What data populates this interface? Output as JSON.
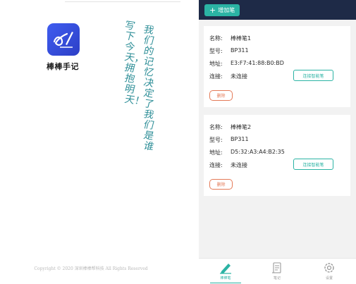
{
  "splash": {
    "app_name": "棒棒手记",
    "poem_col1": "我们的记忆决定了我们是谁",
    "poem_col2": "写下今天，拥抱明天！",
    "copyright": "Copyright © 2020 深圳棒棒帮科技 All Rights Reserved",
    "icon": "pen-alpha-icon"
  },
  "pen_list": {
    "add_button": "增加笔",
    "labels": {
      "name": "名称:",
      "model": "型号:",
      "address": "地址:",
      "connection": "连接:"
    },
    "pens": [
      {
        "name": "棒棒笔1",
        "model": "BP311",
        "address": "E3:F7:41:88:B0:BD",
        "status": "未连接",
        "connect": "连接智能笔",
        "delete": "删除"
      },
      {
        "name": "棒棒笔2",
        "model": "BP311",
        "address": "D5:32:A3:A4:B2:35",
        "status": "未连接",
        "connect": "连接智能笔",
        "delete": "删除"
      }
    ]
  },
  "tabs": [
    {
      "label": "棒棒笔",
      "icon": "pen-icon",
      "active": true
    },
    {
      "label": "笔记",
      "icon": "scroll-icon",
      "active": false
    },
    {
      "label": "设置",
      "icon": "gear-icon",
      "active": false
    }
  ],
  "colors": {
    "accent": "#2bb3a4",
    "appbar": "#1e2a47",
    "delete": "#e47a57",
    "icon_bg": "#3f5df0"
  }
}
